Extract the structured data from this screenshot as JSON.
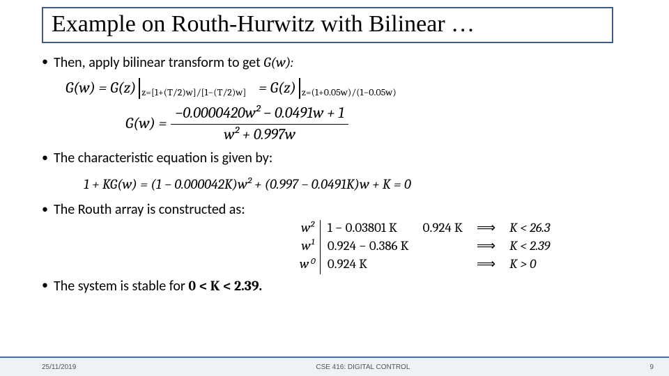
{
  "title": "Example on Routh-Hurwitz with Bilinear …",
  "bullets": {
    "b1_prefix": "Then, apply bilinear transform to get ",
    "b1_math": "G(w):",
    "b2": "The characteristic equation is given by:",
    "b3": "The Routh array is constructed as:",
    "b4_prefix": "The system is stable for ",
    "b4_math": "0 < K < 2.39."
  },
  "eq1": {
    "lhs": "G(w)  =  G(z)",
    "sub1": "z=[1+(T/2)w]/[1−(T/2)w]",
    "mid": "=  G(z)",
    "sub2": "z=(1+0.05w)/(1−0.05w)"
  },
  "eq2": {
    "lhs": "G(w)  =",
    "num": "−0.0000420w²  −  0.0491w  +  1",
    "den": "w²  +  0.997w"
  },
  "eq3": "1  +  KG(w)  =  (1  −  0.000042K)w²  +  (0.997  −  0.0491K)w  +  K  =  0",
  "routh": {
    "r1_label": "w²",
    "r2_label": "w¹",
    "r3_label": "w⁰",
    "r1_c1": "1 − 0.03801 K",
    "r1_c2": "0.924 K",
    "r2_c1": "0.924 − 0.386 K",
    "r3_c1": "0.924 K",
    "imp": "⟹",
    "r1_res": "K < 26.3",
    "r2_res": "K < 2.39",
    "r3_res": "K > 0"
  },
  "footer": {
    "date": "25/11/2019",
    "course": "CSE 416: DIGITAL CONTROL",
    "page": "9"
  }
}
